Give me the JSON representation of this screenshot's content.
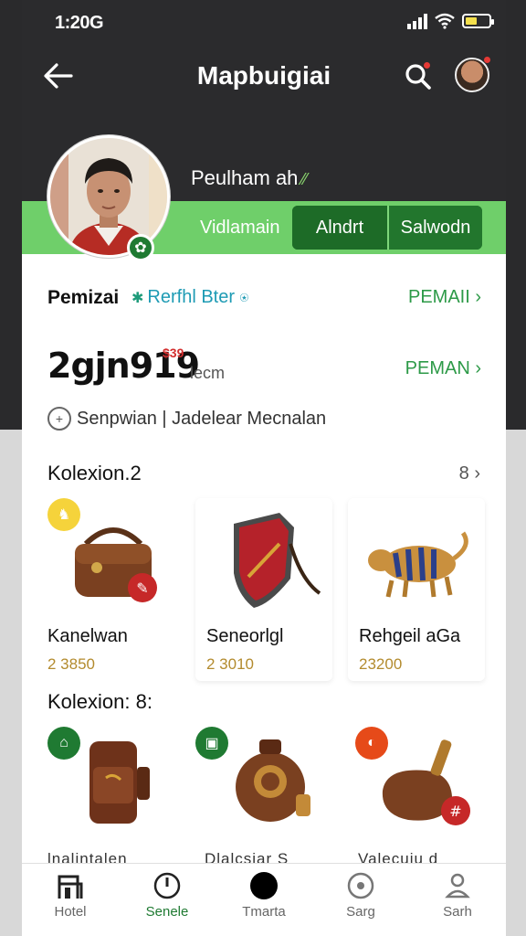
{
  "status_bar": {
    "time": "1:20G"
  },
  "nav": {
    "title": "Mapbuigiai"
  },
  "profile": {
    "name": "Peulham ah",
    "strip_label": "Vidlamain",
    "button_1": "Alndrt",
    "button_2": "Salwodn"
  },
  "stats": {
    "row1_label": "Pemizai",
    "row1_sub": "Rerfhl Bter",
    "row1_link": "PEMAII ›",
    "big_number": "2gjn919",
    "big_number_sup": "$39",
    "big_unit": "lecm",
    "row2_link": "PEMAN ›",
    "info_text": "Senpwian | Jadelear Mecnalan"
  },
  "collection_1": {
    "title": "Kolexion.2",
    "count": "8 ›",
    "items": [
      {
        "name": "Kanelwan",
        "price": "2 3850"
      },
      {
        "name": "Seneorlgl",
        "price": "2 3010"
      },
      {
        "name": "Rehgeil aGa",
        "price": "23200"
      }
    ]
  },
  "collection_2": {
    "title": "Kolexion: 8:",
    "items": [
      {
        "name": "lnalintalen"
      },
      {
        "name": "Dlalcsiar S"
      },
      {
        "name": "Valecuiu d"
      }
    ]
  },
  "tabs": [
    {
      "label": "Hotel",
      "icon": "building-icon"
    },
    {
      "label": "Senele",
      "icon": "clock-icon"
    },
    {
      "label": "Tmarta",
      "icon": "circle-icon"
    },
    {
      "label": "Sarg",
      "icon": "target-icon"
    },
    {
      "label": "Sarh",
      "icon": "person-icon"
    }
  ],
  "colors": {
    "header_bg": "#2b2b2d",
    "green_strip": "#6fcf6a",
    "green_button": "#1d6b27",
    "accent_green": "#2d9a48",
    "price_gold": "#b38b2e"
  }
}
